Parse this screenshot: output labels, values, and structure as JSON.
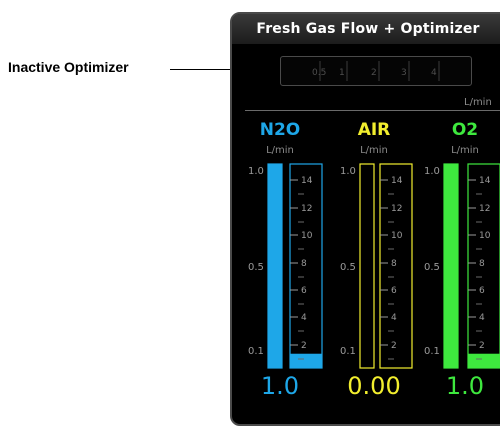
{
  "callout": {
    "label": "Inactive Optimizer"
  },
  "panel": {
    "title": "Fresh Gas Flow + Optimizer",
    "optimizer": {
      "scale_labels": [
        "0.5",
        "1",
        "2",
        "3",
        "4"
      ],
      "unit": "L/min",
      "state": "inactive"
    },
    "ratio_scale_labels": [
      "1.0",
      "0.5",
      "0.1"
    ],
    "flow_scale_labels": [
      "14",
      "12",
      "10",
      "8",
      "6",
      "4",
      "2"
    ],
    "gases": [
      {
        "name": "N2O",
        "unit": "L/min",
        "value": "1.0",
        "color": "#1ea7e8",
        "ratio_fill": 1.0,
        "flow_fill": 0.07
      },
      {
        "name": "AIR",
        "unit": "L/min",
        "value": "0.00",
        "color": "#f2ee2e",
        "ratio_fill": 0.0,
        "flow_fill": 0.0
      },
      {
        "name": "O2",
        "unit": "L/min",
        "value": "1.0",
        "color": "#3ee83e",
        "ratio_fill": 1.0,
        "flow_fill": 0.07
      }
    ]
  }
}
